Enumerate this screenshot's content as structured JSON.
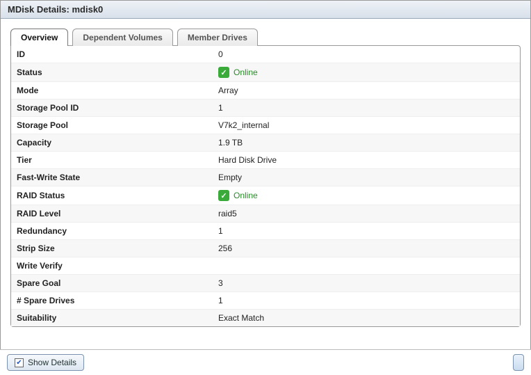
{
  "title": "MDisk Details: mdisk0",
  "tabs": {
    "overview": "Overview",
    "dependent": "Dependent Volumes",
    "member": "Member Drives"
  },
  "rows": {
    "id": {
      "label": "ID",
      "value": "0"
    },
    "status": {
      "label": "Status",
      "value": "Online"
    },
    "mode": {
      "label": "Mode",
      "value": "Array"
    },
    "pool_id": {
      "label": "Storage Pool ID",
      "value": "1"
    },
    "pool": {
      "label": "Storage Pool",
      "value": "V7k2_internal"
    },
    "capacity": {
      "label": "Capacity",
      "value": "1.9 TB"
    },
    "tier": {
      "label": "Tier",
      "value": "Hard Disk Drive"
    },
    "fastwrite": {
      "label": "Fast-Write State",
      "value": "Empty"
    },
    "raid_status": {
      "label": "RAID Status",
      "value": "Online"
    },
    "raid_level": {
      "label": "RAID Level",
      "value": "raid5"
    },
    "redundancy": {
      "label": "Redundancy",
      "value": "1"
    },
    "strip": {
      "label": "Strip Size",
      "value": "256"
    },
    "write_verify": {
      "label": "Write Verify",
      "value": ""
    },
    "spare_goal": {
      "label": "Spare Goal",
      "value": "3"
    },
    "spare_drives": {
      "label": "# Spare Drives",
      "value": "1"
    },
    "suitability": {
      "label": "Suitability",
      "value": "Exact Match"
    }
  },
  "footer": {
    "show_details": "Show Details"
  }
}
